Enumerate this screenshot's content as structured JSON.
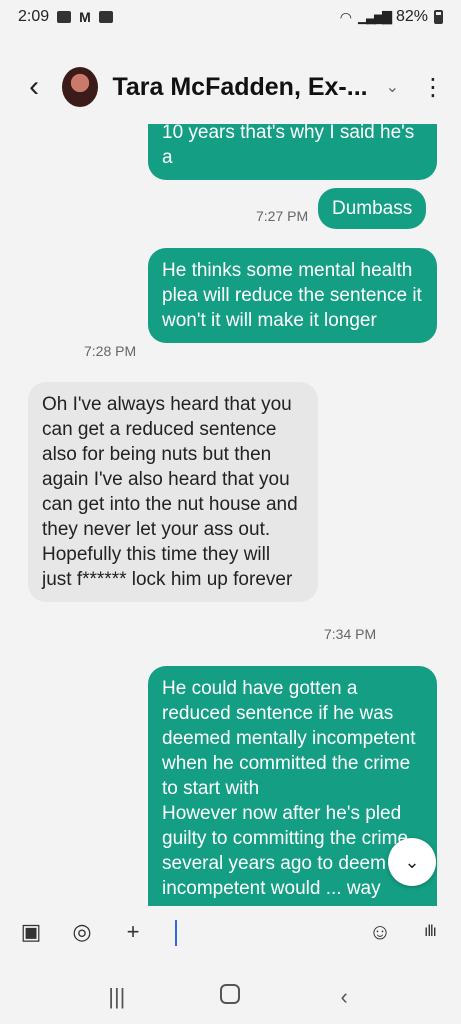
{
  "status_bar": {
    "time": "2:09",
    "battery": "82%"
  },
  "header": {
    "contact_name": "Tara McFadden, Ex-..."
  },
  "messages": [
    {
      "type": "sent",
      "text": "10 years that's why I said he's a"
    },
    {
      "type": "sent",
      "text": "Dumbass",
      "time": "7:27 PM"
    },
    {
      "type": "sent",
      "text": "He thinks some mental health plea will reduce the sentence it won't it will make it longer",
      "time": "7:28 PM"
    },
    {
      "type": "received",
      "text": "Oh I've always heard that you can get a reduced sentence also for being nuts but then again I've also heard that you can get into the nut house and they never let your ass out. Hopefully this time they will just f****** lock him up forever",
      "time": "7:34 PM"
    },
    {
      "type": "sent",
      "text": "He could have gotten a reduced sentence if he was deemed mentally incompetent when he committed the crime to start with\nHowever now after he's pled guilty to committing the crime several years ago to deem him incompetent would ... way"
    }
  ],
  "colors": {
    "sent_bubble": "#149e84",
    "received_bubble": "#e7e7e7",
    "background": "#f3f3f3"
  }
}
